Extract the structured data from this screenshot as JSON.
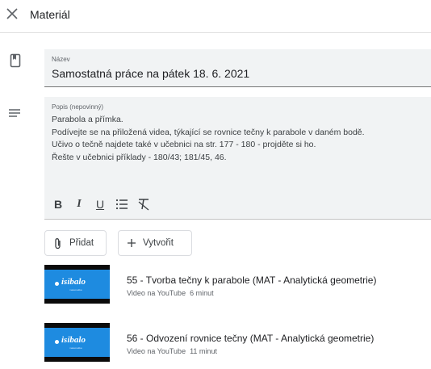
{
  "header": {
    "title": "Materiál"
  },
  "title_field": {
    "label": "Název",
    "value": "Samostatná práce na pátek 18. 6. 2021"
  },
  "description": {
    "label": "Popis (nepovinný)",
    "lines": [
      "Parabola a přímka.",
      "Podívejte se na přiložená videa, týkající se rovnice tečny k parabole v daném bodě.",
      "Učivo o tečně najdete také v učebnici na str. 177 - 180 - projděte si ho.",
      "Řešte v učebnici příklady - 180/43; 181/45, 46."
    ]
  },
  "formatting": {
    "bold": "B",
    "italic": "I",
    "underline": "U"
  },
  "actions": {
    "add_label": "Přidat",
    "create_label": "Vytvořit"
  },
  "attachments": [
    {
      "title": "55 - Tvorba tečny k parabole (MAT - Analytická geometrie)",
      "source": "Video na YouTube",
      "duration": "6 minut",
      "thumb_logo": "isibalo",
      "thumb_sub": "matematika"
    },
    {
      "title": "56 - Odvození rovnice tečny (MAT - Analytická geometrie)",
      "source": "Video na YouTube",
      "duration": "11 minut",
      "thumb_logo": "isibalo",
      "thumb_sub": "matematika"
    }
  ],
  "colors": {
    "field_bg": "#f1f3f4",
    "thumb_blue": "#1e8be0",
    "muted_text": "#5f6368"
  },
  "icons": [
    "close-icon",
    "bookmark-icon",
    "notes-icon",
    "bulleted-list-icon",
    "clear-format-icon",
    "attach-icon",
    "plus-icon"
  ]
}
